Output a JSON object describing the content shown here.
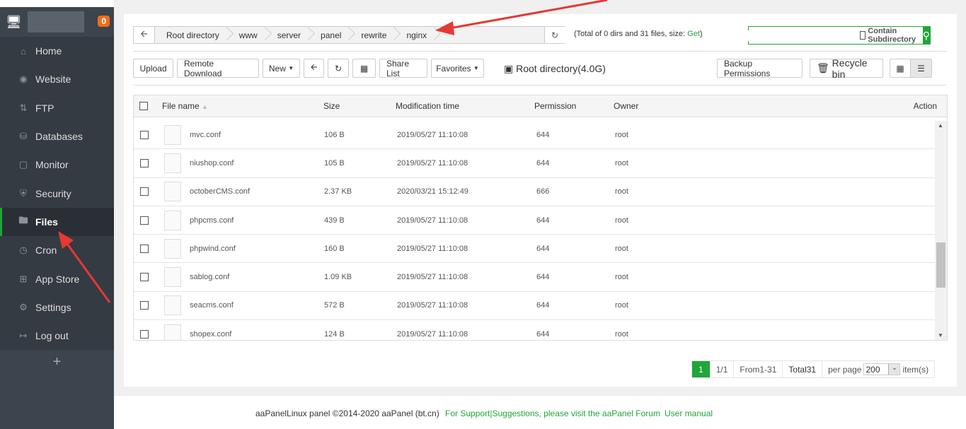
{
  "sidebar": {
    "badge": "0",
    "items": [
      {
        "label": "Home",
        "icon": "home-icon"
      },
      {
        "label": "Website",
        "icon": "globe-icon"
      },
      {
        "label": "FTP",
        "icon": "ftp-icon"
      },
      {
        "label": "Databases",
        "icon": "database-icon"
      },
      {
        "label": "Monitor",
        "icon": "monitor-icon"
      },
      {
        "label": "Security",
        "icon": "shield-icon"
      },
      {
        "label": "Files",
        "icon": "folder-icon",
        "active": true
      },
      {
        "label": "Cron",
        "icon": "clock-icon"
      },
      {
        "label": "App Store",
        "icon": "apps-icon"
      },
      {
        "label": "Settings",
        "icon": "gear-icon"
      },
      {
        "label": "Log out",
        "icon": "logout-icon"
      }
    ],
    "add": "+"
  },
  "breadcrumb": [
    "Root directory",
    "www",
    "server",
    "panel",
    "rewrite",
    "nginx"
  ],
  "summary": {
    "text": "(Total of 0 dirs and 31 files, size: ",
    "link": "Get",
    "end": ")"
  },
  "search": {
    "checkbox_label": "Contain Subdirectory",
    "value": ""
  },
  "toolbar": {
    "upload": "Upload",
    "remote_download": "Remote Download",
    "new": "New",
    "share_list": "Share List",
    "favorites": "Favorites",
    "root_dir": "Root directory(4.0G)",
    "backup_permissions": "Backup Permissions",
    "recycle_bin": "Recycle bin"
  },
  "table": {
    "headers": {
      "name": "File name",
      "size": "Size",
      "mtime": "Modification time",
      "perm": "Permission",
      "owner": "Owner",
      "action": "Action"
    },
    "rows": [
      {
        "name": "mvc.conf",
        "size": "106 B",
        "mtime": "2019/05/27 11:10:08",
        "perm": "644",
        "owner": "root"
      },
      {
        "name": "niushop.conf",
        "size": "105 B",
        "mtime": "2019/05/27 11:10:08",
        "perm": "644",
        "owner": "root"
      },
      {
        "name": "octoberCMS.conf",
        "size": "2.37 KB",
        "mtime": "2020/03/21 15:12:49",
        "perm": "666",
        "owner": "root"
      },
      {
        "name": "phpcms.conf",
        "size": "439 B",
        "mtime": "2019/05/27 11:10:08",
        "perm": "644",
        "owner": "root"
      },
      {
        "name": "phpwind.conf",
        "size": "160 B",
        "mtime": "2019/05/27 11:10:08",
        "perm": "644",
        "owner": "root"
      },
      {
        "name": "sablog.conf",
        "size": "1.09 KB",
        "mtime": "2019/05/27 11:10:08",
        "perm": "644",
        "owner": "root"
      },
      {
        "name": "seacms.conf",
        "size": "572 B",
        "mtime": "2019/05/27 11:10:08",
        "perm": "644",
        "owner": "root"
      },
      {
        "name": "shopex.conf",
        "size": "124 B",
        "mtime": "2019/05/27 11:10:08",
        "perm": "644",
        "owner": "root"
      }
    ]
  },
  "pager": {
    "current": "1",
    "pages": "1/1",
    "range": "From1-31",
    "total": "Total31",
    "per_page_label": "per page",
    "per_page": "200",
    "items_label": "item(s)"
  },
  "footer": {
    "copyright": "aaPanelLinux panel ©2014-2020 aaPanel (bt.cn)",
    "support": "For Support|Suggestions, please visit the aaPanel Forum",
    "manual": "User manual"
  }
}
